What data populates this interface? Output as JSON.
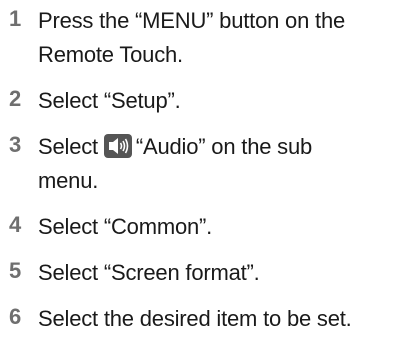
{
  "steps": [
    {
      "number": "1",
      "lines": [
        "Press the “MENU” button on the",
        "Remote Touch."
      ]
    },
    {
      "number": "2",
      "lines": [
        "Select “Setup”."
      ]
    },
    {
      "number": "3",
      "before_icon": "Select",
      "icon": "audio-speaker-icon",
      "after_icon": "“Audio” on the sub",
      "line2": "menu."
    },
    {
      "number": "4",
      "lines": [
        "Select “Common”."
      ]
    },
    {
      "number": "5",
      "lines": [
        "Select “Screen format”."
      ]
    },
    {
      "number": "6",
      "lines": [
        "Select the desired item to be set."
      ]
    }
  ],
  "colors": {
    "number": "#6f6f6f",
    "text": "#1a1a1a",
    "icon_bg": "#555555",
    "icon_fg": "#ffffff"
  }
}
